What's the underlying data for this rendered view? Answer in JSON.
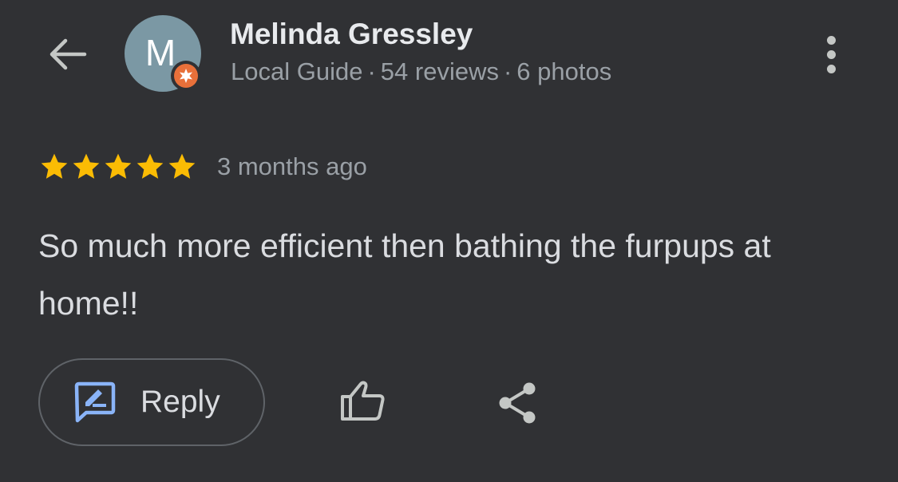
{
  "header": {
    "back_icon": "arrow-left-icon",
    "more_icon": "more-vertical-icon"
  },
  "author": {
    "initial": "M",
    "name": "Melinda Gressley",
    "avatar_color": "#7b98a4",
    "badge_icon": "local-guide-badge-icon",
    "badge_color": "#e8703a",
    "meta": {
      "level": "Local Guide",
      "separator": "·",
      "reviews": "54 reviews",
      "photos": "6 photos"
    }
  },
  "review": {
    "rating": 5,
    "max_rating": 5,
    "star_color": "#fbbc04",
    "date": "3 months ago",
    "text": "So much more efficient then bathing the furpups at home!!"
  },
  "actions": {
    "reply_label": "Reply",
    "reply_icon": "reply-edit-icon",
    "reply_icon_color": "#8ab4f8",
    "like_icon": "thumbs-up-icon",
    "share_icon": "share-icon"
  },
  "colors": {
    "background": "#303134",
    "primary_text": "#e8eaed",
    "secondary_text": "#9aa0a6"
  }
}
